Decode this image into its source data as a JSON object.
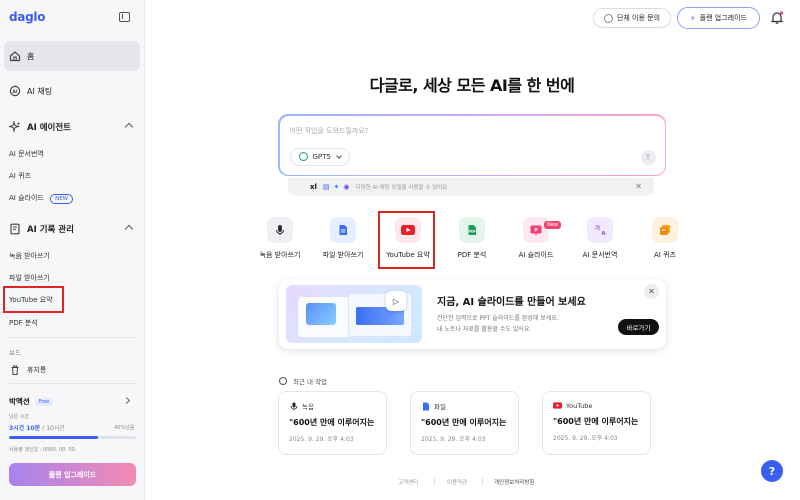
{
  "sidebar": {
    "logo": "daglo",
    "home": "홈",
    "ai_chat": "AI 채팅",
    "agent_section": "AI 에이전트",
    "agent_items": [
      "AI 문서번역",
      "AI 퀴즈",
      "AI 슬라이드"
    ],
    "new_badge": "NEW",
    "record_section": "AI 기록 관리",
    "record_items": [
      "녹음 받아쓰기",
      "파일 받아쓰기",
      "YouTube 요약",
      "PDF 분석"
    ],
    "board_label": "보드",
    "trash": "휴지통",
    "user": {
      "name": "박액션",
      "plan_badge": "Free",
      "remaining_label": "남은 시간",
      "remaining_value": "3시간 10분",
      "remaining_total": "/ 10시간",
      "remaining_pct_label": "40%남음",
      "remaining_fraction": 0.7,
      "renew_label": "사용량 갱신일 : 0000. 00. 00."
    },
    "upgrade_button": "플랜 업그레이드"
  },
  "topbar": {
    "team_inquiry": "단체 이용 문의",
    "upgrade": "플랜 업그레이드"
  },
  "main": {
    "headline": "다글로, 세상 모든 AI를 한 번에",
    "prompt_placeholder": "어떤 작업을 도와드릴까요?",
    "model": "GPT5",
    "model_strip": {
      "prefix": "xl",
      "text": "다양한 AI 채팅 모델을 사용할 수 있어요"
    },
    "tools": [
      {
        "label": "녹음 받아쓰기",
        "color": "#eef0f4",
        "icon": "mic-icon"
      },
      {
        "label": "파일 받아쓰기",
        "color": "#e6efff",
        "icon": "file-icon"
      },
      {
        "label": "YouTube 요약",
        "color": "#ffe8ea",
        "icon": "youtube-icon"
      },
      {
        "label": "PDF 분석",
        "color": "#e3f5ea",
        "icon": "pdf-icon"
      },
      {
        "label": "AI 슬라이드",
        "color": "#ffe8ef",
        "icon": "slide-icon",
        "tag": "New"
      },
      {
        "label": "AI 문서번역",
        "color": "#f2e9ff",
        "icon": "translate-icon"
      },
      {
        "label": "AI 퀴즈",
        "color": "#fff1e0",
        "icon": "quiz-icon"
      }
    ],
    "promo": {
      "title": "지금, AI 슬라이드를 만들어 보세요",
      "desc_line1": "간단한 입력으로 PPT 슬라이드를 완성해 보세요.",
      "desc_line2": "내 노트나 자료를 활용할 수도 있어요.",
      "cta": "바로가기"
    },
    "recent_title": "최근 내 작업",
    "recent_cards": [
      {
        "type": "녹음",
        "title": "\"600년 만에 이루어지는 대...",
        "date": "2025. 9. 29. 오후 4:03"
      },
      {
        "type": "파일",
        "title": "\"600년 만에 이루어지는 대...",
        "date": "2025. 9. 29. 오후 4:03"
      },
      {
        "type": "YouTube",
        "title": "\"600년 만에 이루어지는 대...",
        "date": "2025. 9. 29. 오후 4:03"
      }
    ],
    "footer": [
      "고객센터",
      "이용약관",
      "개인정보처리방침"
    ],
    "help": "?"
  }
}
